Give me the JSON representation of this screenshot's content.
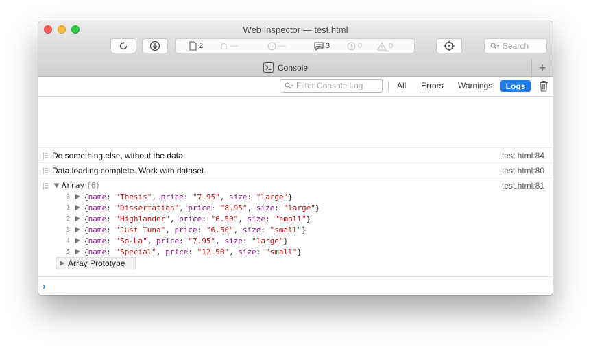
{
  "window": {
    "title": "Web Inspector — test.html"
  },
  "toolbar": {
    "resources_count": "2",
    "timeline_value": "—",
    "time_value": "—",
    "logs_count": "3",
    "errors_count": "0",
    "warnings_count": "0",
    "search_placeholder": "Search"
  },
  "tabbar": {
    "tab_label": "Console"
  },
  "filterbar": {
    "filter_placeholder": "Filter Console Log",
    "all_label": "All",
    "errors_label": "Errors",
    "warnings_label": "Warnings",
    "logs_label": "Logs"
  },
  "messages": [
    {
      "text": "Do something else, without the data",
      "source": "test.html:84"
    },
    {
      "text": "Data loading complete. Work with dataset.",
      "source": "test.html:80"
    }
  ],
  "array_log": {
    "label": "Array",
    "count": "(6)",
    "source": "test.html:81",
    "prototype_label": "Array Prototype",
    "items": [
      {
        "index": "0",
        "name": "\"Thesis\"",
        "price": "\"7.95\"",
        "size": "\"large\""
      },
      {
        "index": "1",
        "name": "\"Dissertation\"",
        "price": "\"8.95\"",
        "size": "\"large\""
      },
      {
        "index": "2",
        "name": "\"Highlander\"",
        "price": "\"6.50\"",
        "size": "\"small\""
      },
      {
        "index": "3",
        "name": "\"Just Tuna\"",
        "price": "\"6.50\"",
        "size": "\"small\""
      },
      {
        "index": "4",
        "name": "\"So-La\"",
        "price": "\"7.95\"",
        "size": "\"large\""
      },
      {
        "index": "5",
        "name": "\"Special\"",
        "price": "\"12.50\"",
        "size": "\"small\""
      }
    ]
  },
  "colors": {
    "accent": "#1c7cf2",
    "string": "#c41a16",
    "key": "#881391",
    "prompt": "#2f7de1"
  }
}
